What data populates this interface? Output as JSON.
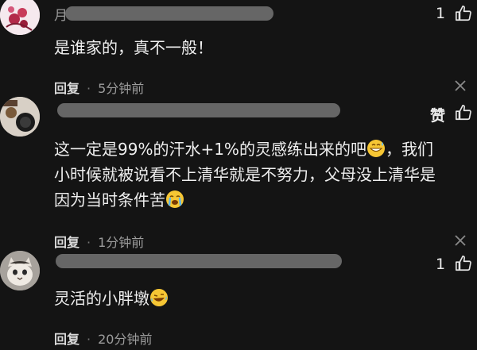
{
  "comments": [
    {
      "username": "月",
      "like_label": "1",
      "text": "是谁家的，真不一般！",
      "reply_label": "回复",
      "time": "5分钟前",
      "avatar_icon": "flower-avatar-icon",
      "close_icon": "close-icon"
    },
    {
      "username": "",
      "like_label": "赞",
      "text_line1": "这一定是99%的汗水+1%的灵感练出来的吧",
      "text_line1_tail": "，我们",
      "text_line2": "小时候就被说看不上清华就是不努力，父母没上清华是",
      "text_line3": "因为当时条件苦",
      "reply_label": "回复",
      "time": "1分钟前",
      "emoji1": "grinning-sweat-emoji",
      "emoji2": "crying-emoji"
    },
    {
      "username": "",
      "like_label": "1",
      "text": "灵活的小胖墩",
      "reply_label": "回复",
      "time": "20分钟前",
      "emoji": "laughing-tears-emoji"
    }
  ],
  "colors": {
    "background": "#141414",
    "text": "#efefef",
    "meta": "#9d9d9d",
    "mask": "#6e6e6e"
  }
}
